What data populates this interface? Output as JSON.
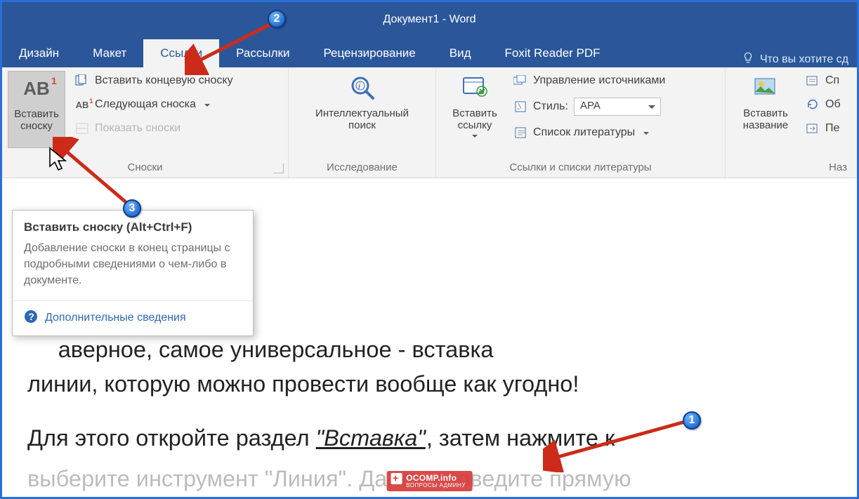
{
  "title": "Документ1  -  Word",
  "tabs": {
    "design": "Дизайн",
    "layout": "Макет",
    "references": "Ссылки",
    "mailings": "Рассылки",
    "review": "Рецензирование",
    "view": "Вид",
    "foxit": "Foxit Reader PDF",
    "tellme": "Что вы хотите сд"
  },
  "ribbon": {
    "footnotes": {
      "insert_footnote": "Вставить\nсноску",
      "ab_glyph": "AB",
      "ab_sup": "1",
      "insert_endnote": "Вставить концевую сноску",
      "next_footnote": "Следующая сноска",
      "show_notes": "Показать сноски",
      "group": "Сноски"
    },
    "research": {
      "smart_lookup": "Интеллектуальный\nпоиск",
      "group": "Исследование"
    },
    "citations": {
      "insert_citation": "Вставить\nссылку",
      "manage_sources": "Управление источниками",
      "style_label": "Стиль:",
      "style_value": "APA",
      "bibliography": "Список литературы",
      "group": "Ссылки и списки литературы"
    },
    "captions": {
      "insert_caption": "Вставить\nназвание",
      "cross_ref_a": "Сп",
      "cross_ref_b": "Об",
      "cross_ref_c": "Пе",
      "group": "Наз"
    }
  },
  "tooltip": {
    "title": "Вставить сноску (Alt+Ctrl+F)",
    "body": "Добавление сноски в конец страницы с подробными сведениями о чем-либо в документе.",
    "more": "Дополнительные сведения"
  },
  "doc": {
    "line1_a": "аверное, самое универсальное - вставка ",
    "line1_b": "линии, которую можно провести вообще как угодно!",
    "line2_a": "Для этого откройте раздел ",
    "line2_kv": "\"Вставка\"",
    "line2_b": ", затем нажмите к",
    "line3_faded": "выберите инструмент \"Линия\". Далее проведите прямую"
  },
  "anno": {
    "n1": "1",
    "n2": "2",
    "n3": "3"
  },
  "wm": {
    "top": "OCOMP.info",
    "sub": "ВОПРОСЫ АДМИНУ"
  }
}
